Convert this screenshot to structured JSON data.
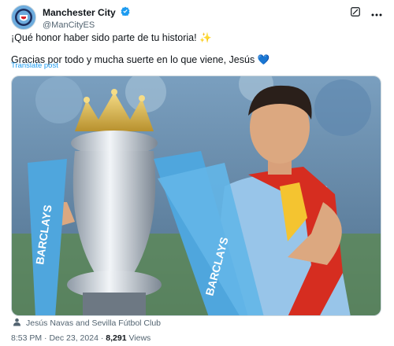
{
  "account": {
    "display_name": "Manchester City",
    "handle": "@ManCityES"
  },
  "tweet": {
    "line1": "¡Qué honor haber sido parte de tu historia! ✨",
    "line2": "Gracias por todo y mucha suerte en lo que viene, Jesús 💙",
    "translate_label": "Translate post"
  },
  "media": {
    "tag_text": "Jesús Navas and Sevilla Fútbol Club",
    "sponsor_text": "BARCLAYS"
  },
  "meta": {
    "time": "8:53 PM",
    "separator": "·",
    "date": "Dec 23, 2024",
    "views_count": "8,291",
    "views_label": "Views"
  },
  "icons": [
    "verified-badge-icon",
    "grok-icon",
    "more-icon",
    "person-tag-icon"
  ],
  "colors": {
    "accent": "#1d9bf0",
    "muted": "#536471",
    "city_blue": "#6cabdd"
  }
}
